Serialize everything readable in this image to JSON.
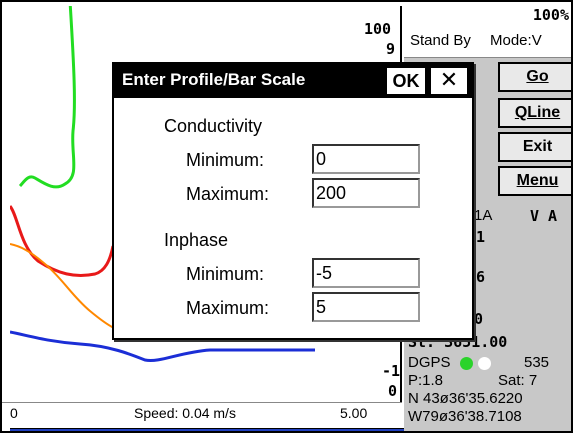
{
  "plot": {
    "top_scale": "100",
    "top_scale_partial": "9",
    "bottom_scale_neg": "-1",
    "bottom_scale_zero": "0",
    "axis_start": "0",
    "speed": "Speed: 0.04 m/s",
    "axis_end": "5.00",
    "colors": {
      "conductivity": "#22dd22",
      "inphase": "#e81919",
      "quadrature": "#ff8800",
      "blue": "#1b2ed6"
    }
  },
  "status": {
    "battery": "100%",
    "state": "Stand By",
    "mode": "Mode:V"
  },
  "buttons": {
    "go": "Go",
    "qline": "QLine",
    "exit": "Exit",
    "menu": "Menu"
  },
  "panel": {
    "channel_partial": "1A",
    "va": "V A",
    "v1": "1",
    "v6": "6",
    "v0": "0",
    "st_value": "St: 3651.00",
    "dgps": "DGPS",
    "dgps_num": "535",
    "pdop": "P:1.8",
    "sat": "Sat: 7",
    "lat": "N 43ø36'35.6220",
    "lon": "W79ø36'38.7108"
  },
  "dialog": {
    "title": "Enter Profile/Bar Scale",
    "ok": "OK",
    "close": "✕",
    "conductivity_label": "Conductivity",
    "inphase_label": "Inphase",
    "min_label": "Minimum:",
    "max_label": "Maximum:",
    "cond_min": "0",
    "cond_max": "200",
    "inph_min": "-5",
    "inph_max": "5"
  }
}
